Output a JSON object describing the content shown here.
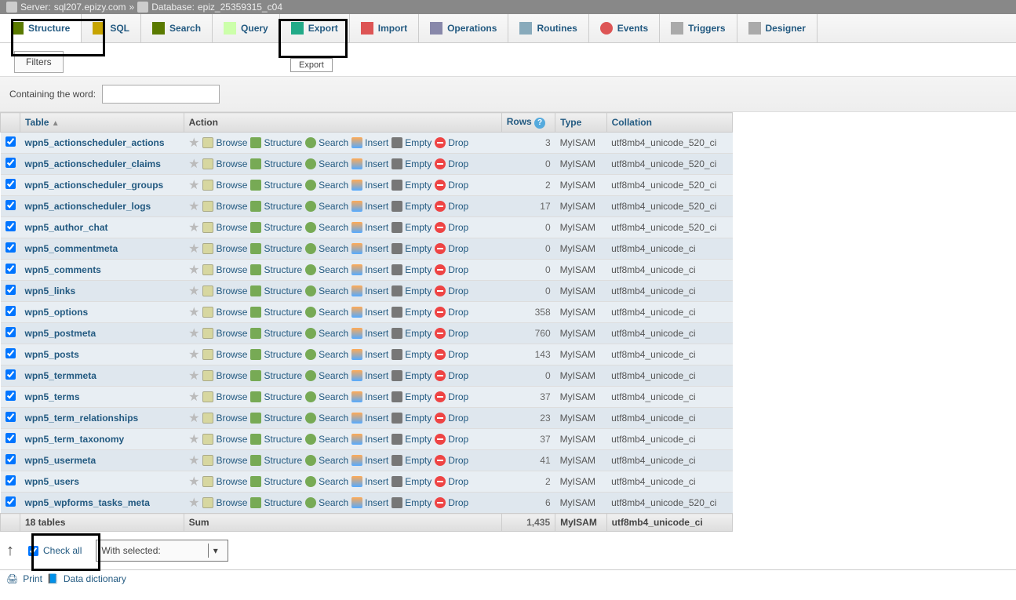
{
  "breadcrumb": {
    "server_label": "Server:",
    "server_name": "sql207.epizy.com",
    "sep": "»",
    "db_label": "Database:",
    "db_name": "epiz_25359315_c04"
  },
  "tabs": {
    "structure": "Structure",
    "sql": "SQL",
    "search": "Search",
    "query": "Query",
    "export": "Export",
    "import": "Import",
    "operations": "Operations",
    "routines": "Routines",
    "events": "Events",
    "triggers": "Triggers",
    "designer": "Designer",
    "export_tooltip": "Export"
  },
  "filters": {
    "button": "Filters",
    "containing_label": "Containing the word:",
    "input_value": ""
  },
  "headers": {
    "table": "Table",
    "action": "Action",
    "rows": "Rows",
    "type": "Type",
    "collation": "Collation"
  },
  "actions": {
    "browse": "Browse",
    "structure": "Structure",
    "search": "Search",
    "insert": "Insert",
    "empty": "Empty",
    "drop": "Drop"
  },
  "tables": [
    {
      "name": "wpn5_actionscheduler_actions",
      "rows": "3",
      "type": "MyISAM",
      "coll": "utf8mb4_unicode_520_ci"
    },
    {
      "name": "wpn5_actionscheduler_claims",
      "rows": "0",
      "type": "MyISAM",
      "coll": "utf8mb4_unicode_520_ci"
    },
    {
      "name": "wpn5_actionscheduler_groups",
      "rows": "2",
      "type": "MyISAM",
      "coll": "utf8mb4_unicode_520_ci"
    },
    {
      "name": "wpn5_actionscheduler_logs",
      "rows": "17",
      "type": "MyISAM",
      "coll": "utf8mb4_unicode_520_ci"
    },
    {
      "name": "wpn5_author_chat",
      "rows": "0",
      "type": "MyISAM",
      "coll": "utf8mb4_unicode_520_ci"
    },
    {
      "name": "wpn5_commentmeta",
      "rows": "0",
      "type": "MyISAM",
      "coll": "utf8mb4_unicode_ci"
    },
    {
      "name": "wpn5_comments",
      "rows": "0",
      "type": "MyISAM",
      "coll": "utf8mb4_unicode_ci"
    },
    {
      "name": "wpn5_links",
      "rows": "0",
      "type": "MyISAM",
      "coll": "utf8mb4_unicode_ci"
    },
    {
      "name": "wpn5_options",
      "rows": "358",
      "type": "MyISAM",
      "coll": "utf8mb4_unicode_ci"
    },
    {
      "name": "wpn5_postmeta",
      "rows": "760",
      "type": "MyISAM",
      "coll": "utf8mb4_unicode_ci"
    },
    {
      "name": "wpn5_posts",
      "rows": "143",
      "type": "MyISAM",
      "coll": "utf8mb4_unicode_ci"
    },
    {
      "name": "wpn5_termmeta",
      "rows": "0",
      "type": "MyISAM",
      "coll": "utf8mb4_unicode_ci"
    },
    {
      "name": "wpn5_terms",
      "rows": "37",
      "type": "MyISAM",
      "coll": "utf8mb4_unicode_ci"
    },
    {
      "name": "wpn5_term_relationships",
      "rows": "23",
      "type": "MyISAM",
      "coll": "utf8mb4_unicode_ci"
    },
    {
      "name": "wpn5_term_taxonomy",
      "rows": "37",
      "type": "MyISAM",
      "coll": "utf8mb4_unicode_ci"
    },
    {
      "name": "wpn5_usermeta",
      "rows": "41",
      "type": "MyISAM",
      "coll": "utf8mb4_unicode_ci"
    },
    {
      "name": "wpn5_users",
      "rows": "2",
      "type": "MyISAM",
      "coll": "utf8mb4_unicode_ci"
    },
    {
      "name": "wpn5_wpforms_tasks_meta",
      "rows": "6",
      "type": "MyISAM",
      "coll": "utf8mb4_unicode_520_ci"
    }
  ],
  "summary": {
    "count_label": "18 tables",
    "sum_label": "Sum",
    "rows_total": "1,435",
    "type": "MyISAM",
    "coll": "utf8mb4_unicode_ci"
  },
  "bottom": {
    "check_all": "Check all",
    "with_selected": "With selected:"
  },
  "footer": {
    "print": "Print",
    "data_dict": "Data dictionary"
  }
}
